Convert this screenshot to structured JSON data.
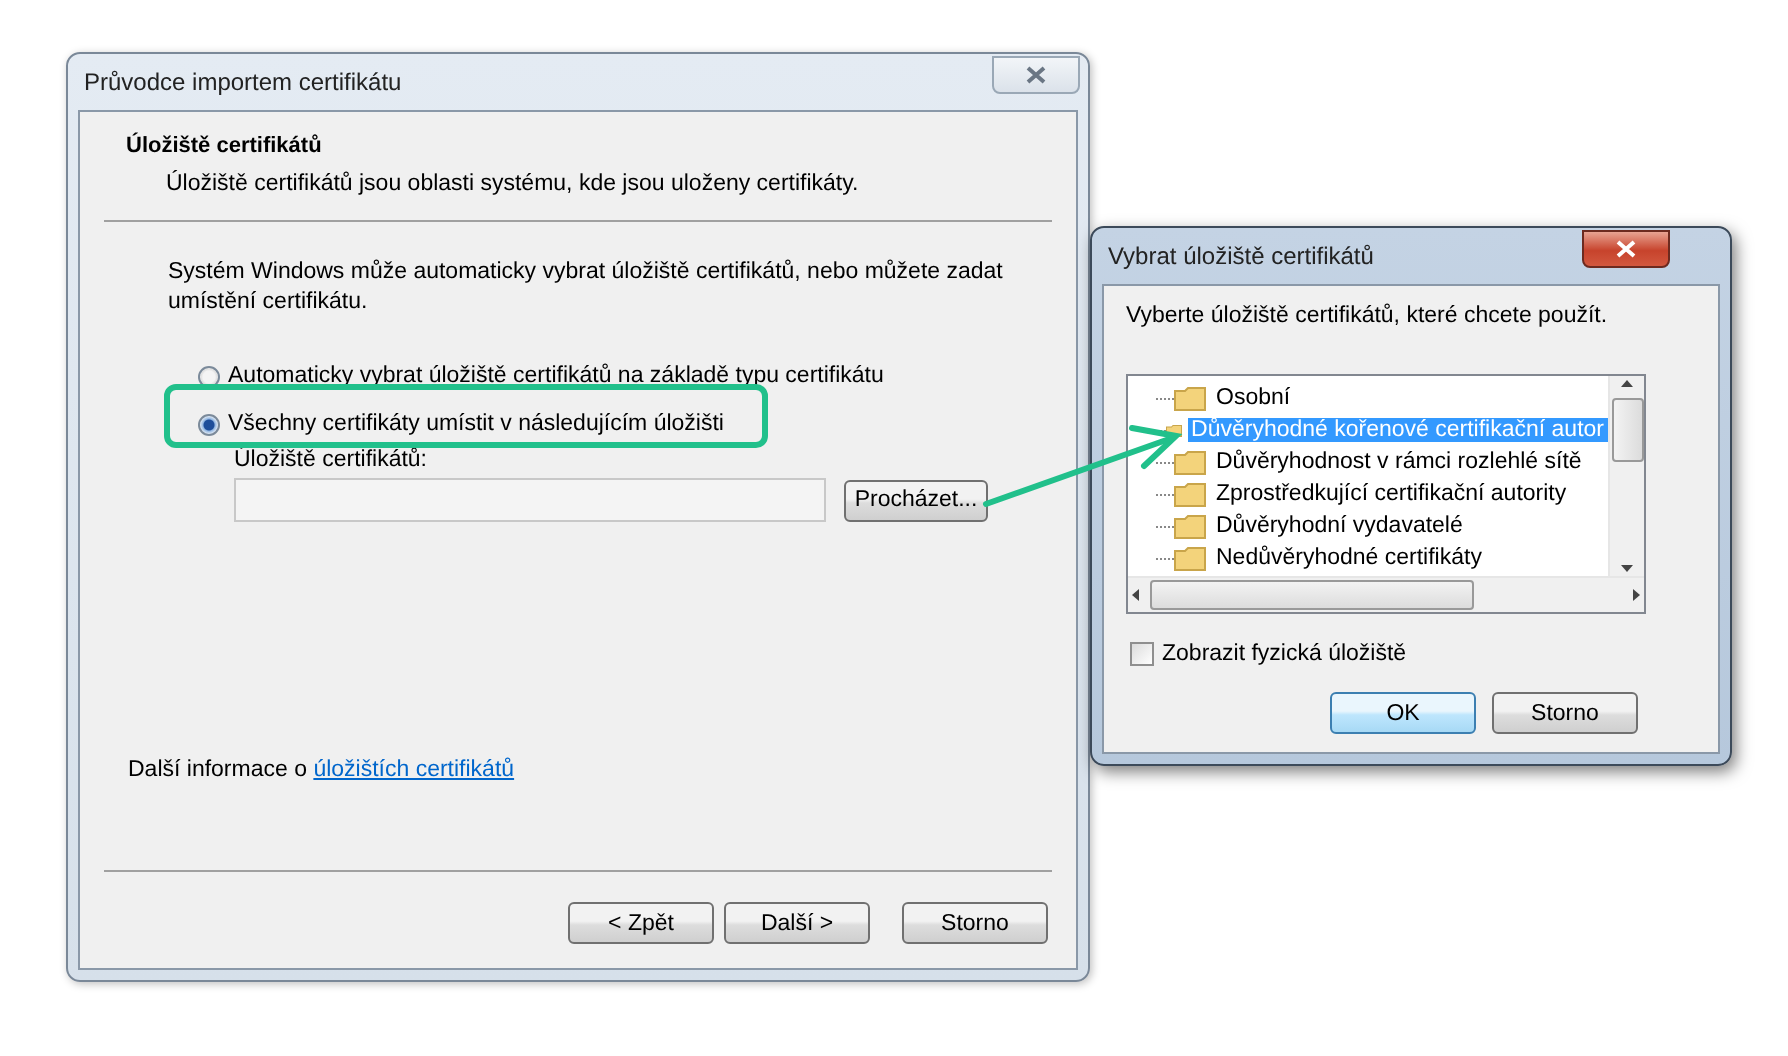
{
  "wizard": {
    "title": "Průvodce importem certifikátu",
    "header": {
      "title": "Úložiště certifikátů",
      "subtitle": "Úložiště certifikátů jsou oblasti systému, kde jsou uloženy certifikáty."
    },
    "intro": "Systém Windows může automaticky vybrat úložiště certifikátů, nebo můžete zadat umístění certifikátu.",
    "options": [
      {
        "label": "Automaticky vybrat úložiště certifikátů na základě typu certifikátu",
        "selected": false
      },
      {
        "label": "Všechny certifikáty umístit v následujícím úložišti",
        "selected": true
      }
    ],
    "store_label": "Úložiště certifikátů:",
    "browse_button": "Procházet...",
    "info": {
      "text": "Další informace o ",
      "link": "úložištích certifikátů"
    },
    "buttons": [
      "< Zpět",
      "Další >",
      "Storno"
    ]
  },
  "picker": {
    "title": "Vybrat úložiště certifikátů",
    "prompt": "Vyberte úložiště certifikátů, které chcete použít.",
    "tree": [
      {
        "label": "Osobní",
        "selected": false
      },
      {
        "label": "Důvěryhodné kořenové certifikační autor",
        "selected": true
      },
      {
        "label": "Důvěryhodnost v rámci rozlehlé sítě",
        "selected": false
      },
      {
        "label": "Zprostředkující certifikační autority",
        "selected": false
      },
      {
        "label": "Důvěryhodní vydavatelé",
        "selected": false
      },
      {
        "label": "Nedůvěryhodné certifikáty",
        "selected": false
      }
    ],
    "show_physical": {
      "label": "Zobrazit fyzická úložiště",
      "checked": false
    },
    "buttons": [
      {
        "label": "OK",
        "default": true
      },
      {
        "label": "Storno",
        "default": false
      }
    ]
  }
}
